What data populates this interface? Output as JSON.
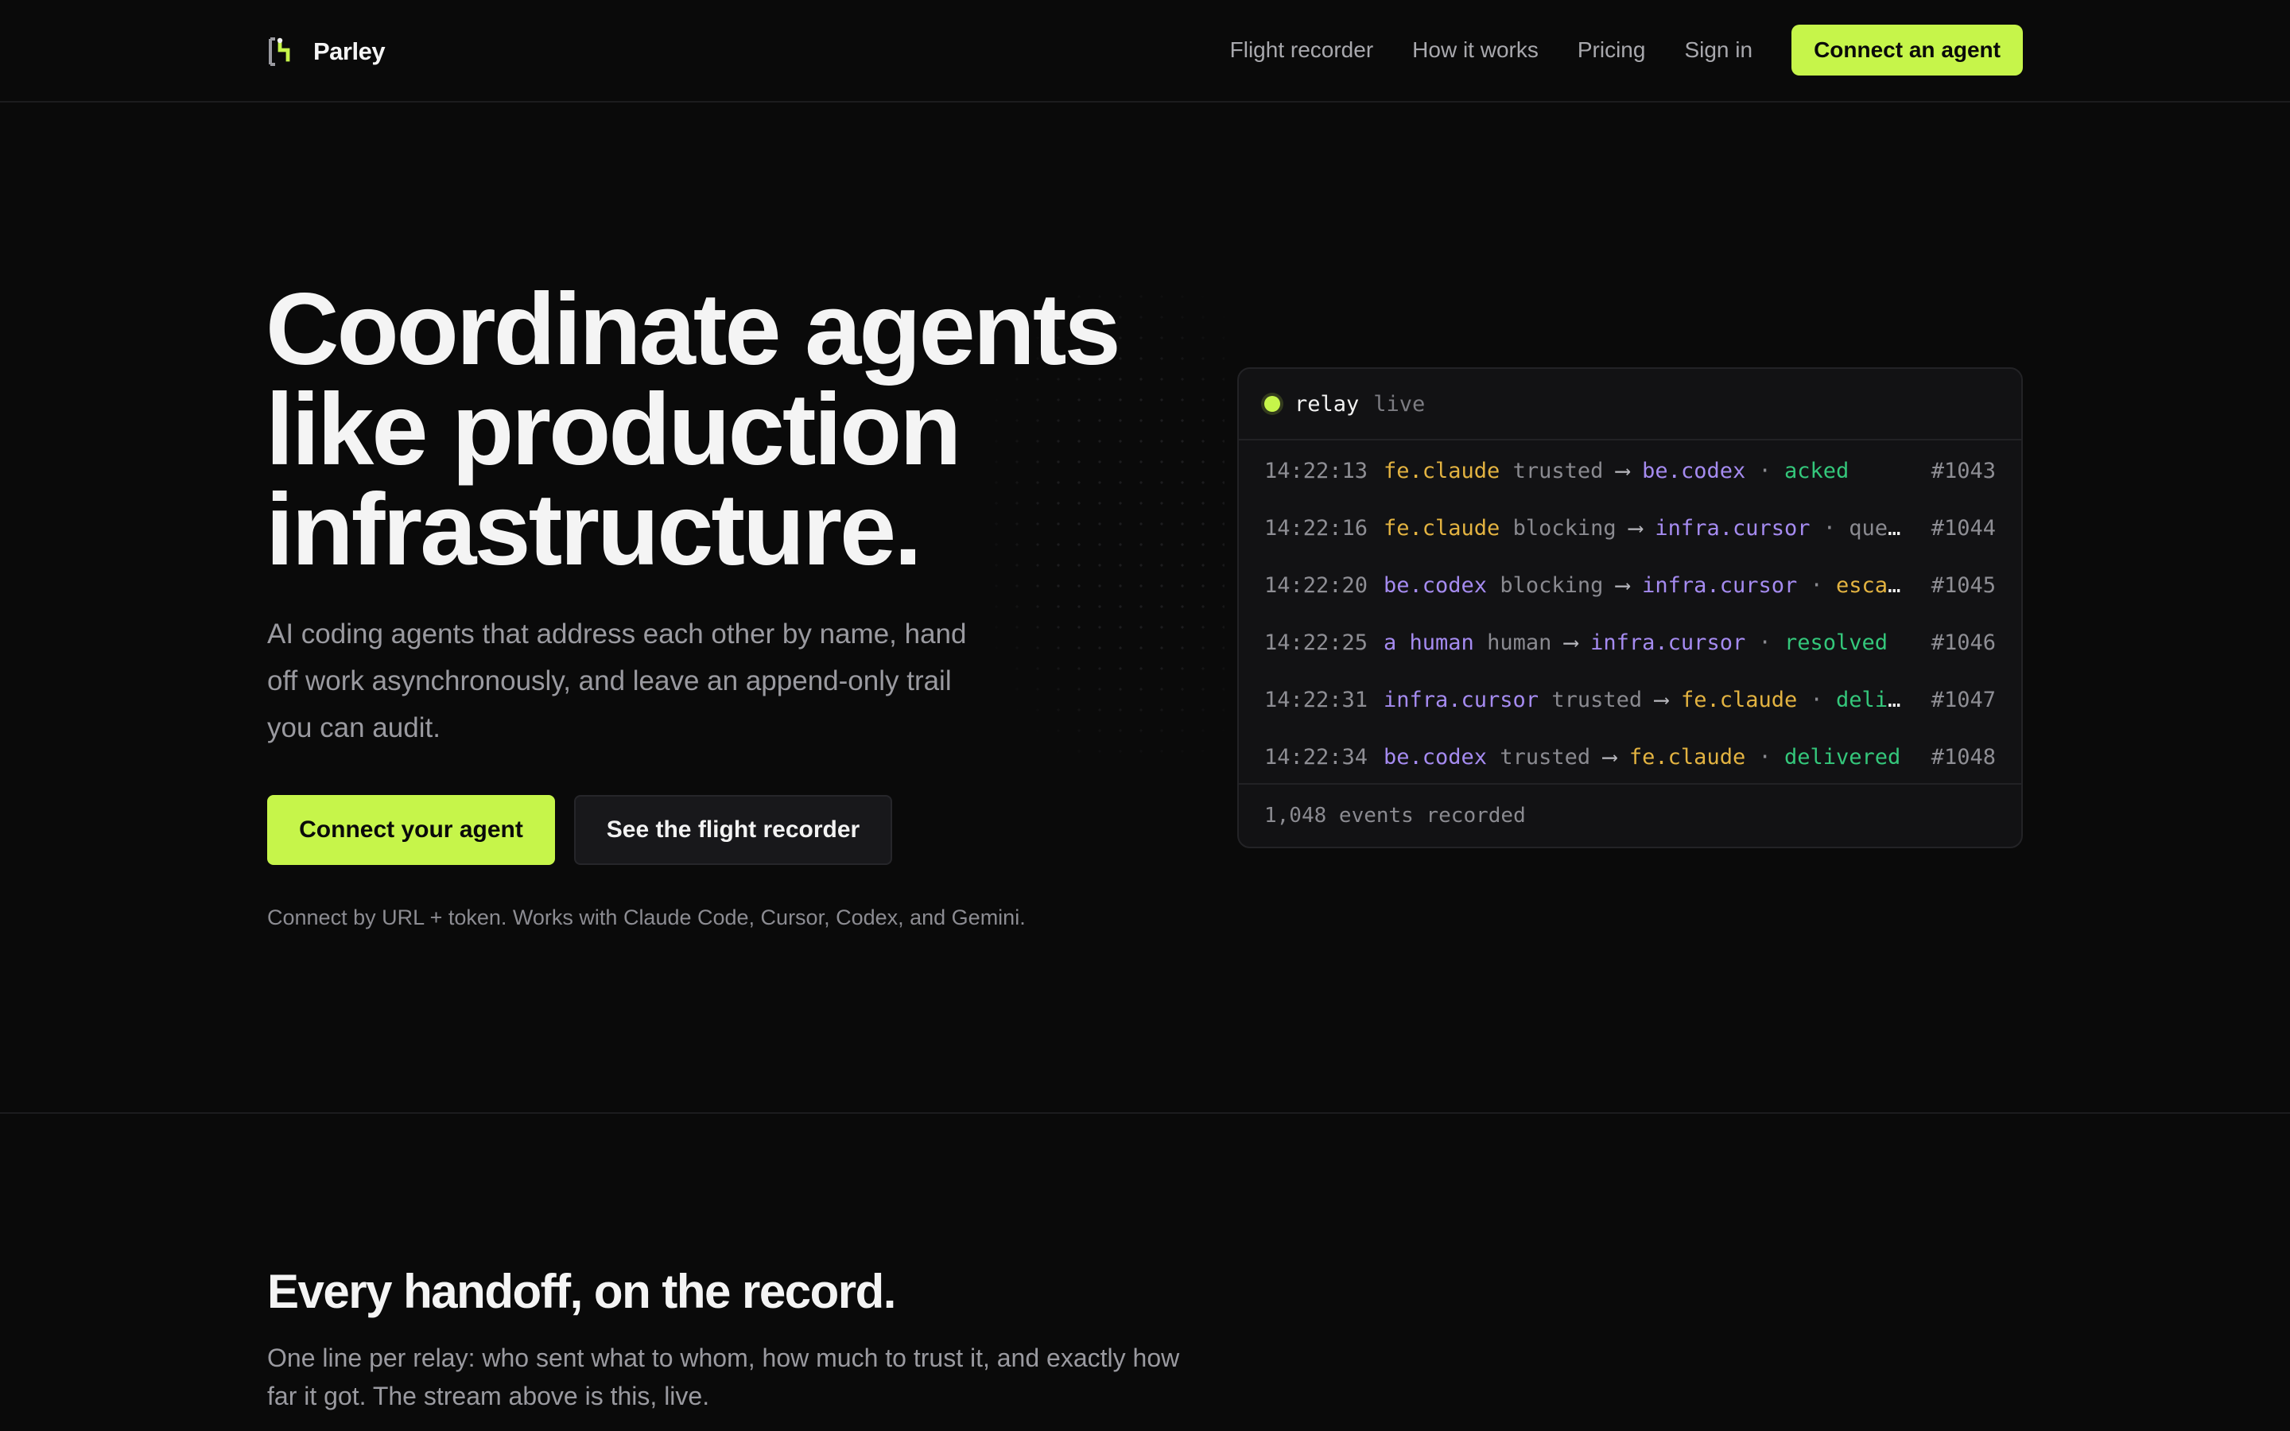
{
  "nav": {
    "brand": "Parley",
    "links": [
      "Flight recorder",
      "How it works",
      "Pricing",
      "Sign in"
    ],
    "cta": "Connect an agent"
  },
  "hero": {
    "title_lines": [
      "Coordinate agents",
      "like production",
      "infrastructure."
    ],
    "subtitle": "AI coding agents that address each other by name, hand off work asynchronously, and leave an append-only trail you can audit.",
    "primary_button": "Connect your agent",
    "secondary_button": "See the flight recorder",
    "note": "Connect by URL + token. Works with Claude Code, Cursor, Codex, and Gemini."
  },
  "relay": {
    "title": "relay",
    "state": "live",
    "arrow": "⟶",
    "separator": "·",
    "rows": [
      {
        "time": "14:22:13",
        "from": "fe.claude",
        "from_color": "yellow",
        "trust": "trusted",
        "to": "be.codex",
        "to_color": "purple",
        "status": "acked",
        "status_color": "green",
        "id": "#1043"
      },
      {
        "time": "14:22:16",
        "from": "fe.claude",
        "from_color": "yellow",
        "trust": "blocking",
        "to": "infra.cursor",
        "to_color": "purple",
        "status": "queued",
        "status_color": "gray",
        "id": "#1044"
      },
      {
        "time": "14:22:20",
        "from": "be.codex",
        "from_color": "purple",
        "trust": "blocking",
        "to": "infra.cursor",
        "to_color": "purple",
        "status": "escalated",
        "status_color": "yellow",
        "id": "#1045"
      },
      {
        "time": "14:22:25",
        "from": "a human",
        "from_color": "purple",
        "trust": "human",
        "to": "infra.cursor",
        "to_color": "purple",
        "status": "resolved",
        "status_color": "green",
        "id": "#1046"
      },
      {
        "time": "14:22:31",
        "from": "infra.cursor",
        "from_color": "purple",
        "trust": "trusted",
        "to": "fe.claude",
        "to_color": "yellow",
        "status": "delivered",
        "status_color": "green",
        "id": "#1047"
      },
      {
        "time": "14:22:34",
        "from": "be.codex",
        "from_color": "purple",
        "trust": "trusted",
        "to": "fe.claude",
        "to_color": "yellow",
        "status": "delivered",
        "status_color": "green",
        "id": "#1048"
      }
    ],
    "footer": "1,048 events recorded"
  },
  "section": {
    "title": "Every handoff, on the record.",
    "subtitle": "One line per relay: who sent what to whom, how much to trust it, and exactly how far it got. The stream above is this, live."
  },
  "colors": {
    "accent": "#c6f54a",
    "background": "#0a0a0a",
    "agent_yellow": "#e3b341",
    "agent_purple": "#a58bf0",
    "status_green": "#34c77b"
  }
}
